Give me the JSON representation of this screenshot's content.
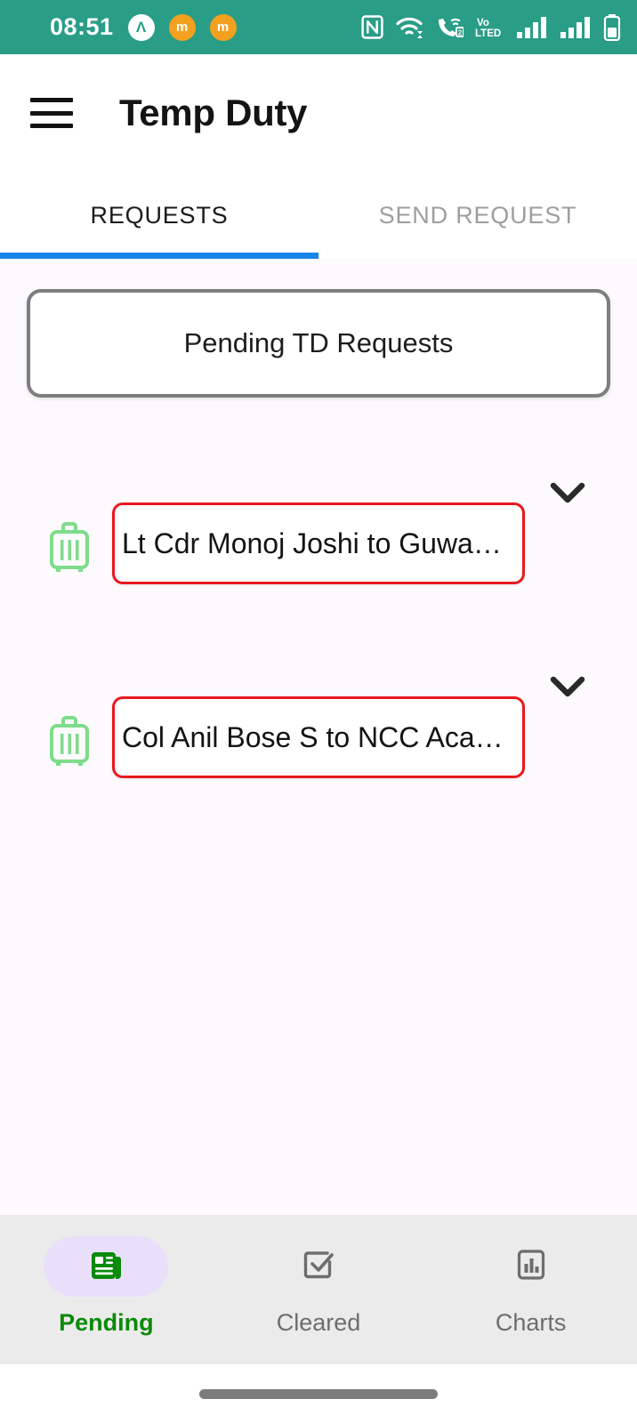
{
  "status_bar": {
    "clock": "08:51",
    "left_icons": [
      {
        "name": "app-badge-a-icon",
        "glyph": "Λ"
      },
      {
        "name": "app-badge-orange-1-icon",
        "glyph": "m"
      },
      {
        "name": "app-badge-orange-2-icon",
        "glyph": "m"
      }
    ],
    "right_icons": [
      {
        "name": "nfc-icon",
        "label": "N"
      },
      {
        "name": "wifi-icon",
        "label": "WiFi"
      },
      {
        "name": "vowifi-call-icon",
        "label": "2"
      },
      {
        "name": "volte-icon",
        "label": "Vo LTED"
      },
      {
        "name": "signal-sim1-icon",
        "label": "Signal 1"
      },
      {
        "name": "signal-sim2-icon",
        "label": "Signal 2"
      },
      {
        "name": "battery-icon",
        "label": "Battery"
      }
    ],
    "background_color": "#2A9D87"
  },
  "app_bar": {
    "menu_icon": "hamburger-menu-icon",
    "title": "Temp Duty"
  },
  "tabs": {
    "items": [
      {
        "label": "REQUESTS",
        "active": true
      },
      {
        "label": "SEND REQUEST",
        "active": false
      }
    ],
    "indicator_color": "#1A85E8"
  },
  "main": {
    "section_header": "Pending TD Requests",
    "requests": [
      {
        "leading_icon": "suitcase-icon",
        "text": "Lt Cdr Monoj Joshi to Guwa…",
        "expand_icon": "chevron-down-icon",
        "border_color": "#E8191E"
      },
      {
        "leading_icon": "suitcase-icon",
        "text": "Col Anil Bose S to NCC Aca…",
        "expand_icon": "chevron-down-icon",
        "border_color": "#E8191E"
      }
    ]
  },
  "bottom_nav": {
    "items": [
      {
        "label": "Pending",
        "icon": "newspaper-icon",
        "active": true
      },
      {
        "label": "Cleared",
        "icon": "checkbox-check-icon",
        "active": false
      },
      {
        "label": "Charts",
        "icon": "bar-chart-icon",
        "active": false
      }
    ],
    "active_color": "#0A8A0A",
    "active_pill_color": "#E9DFFA"
  },
  "gesture_bar": {
    "handle": "home-gesture-handle"
  }
}
